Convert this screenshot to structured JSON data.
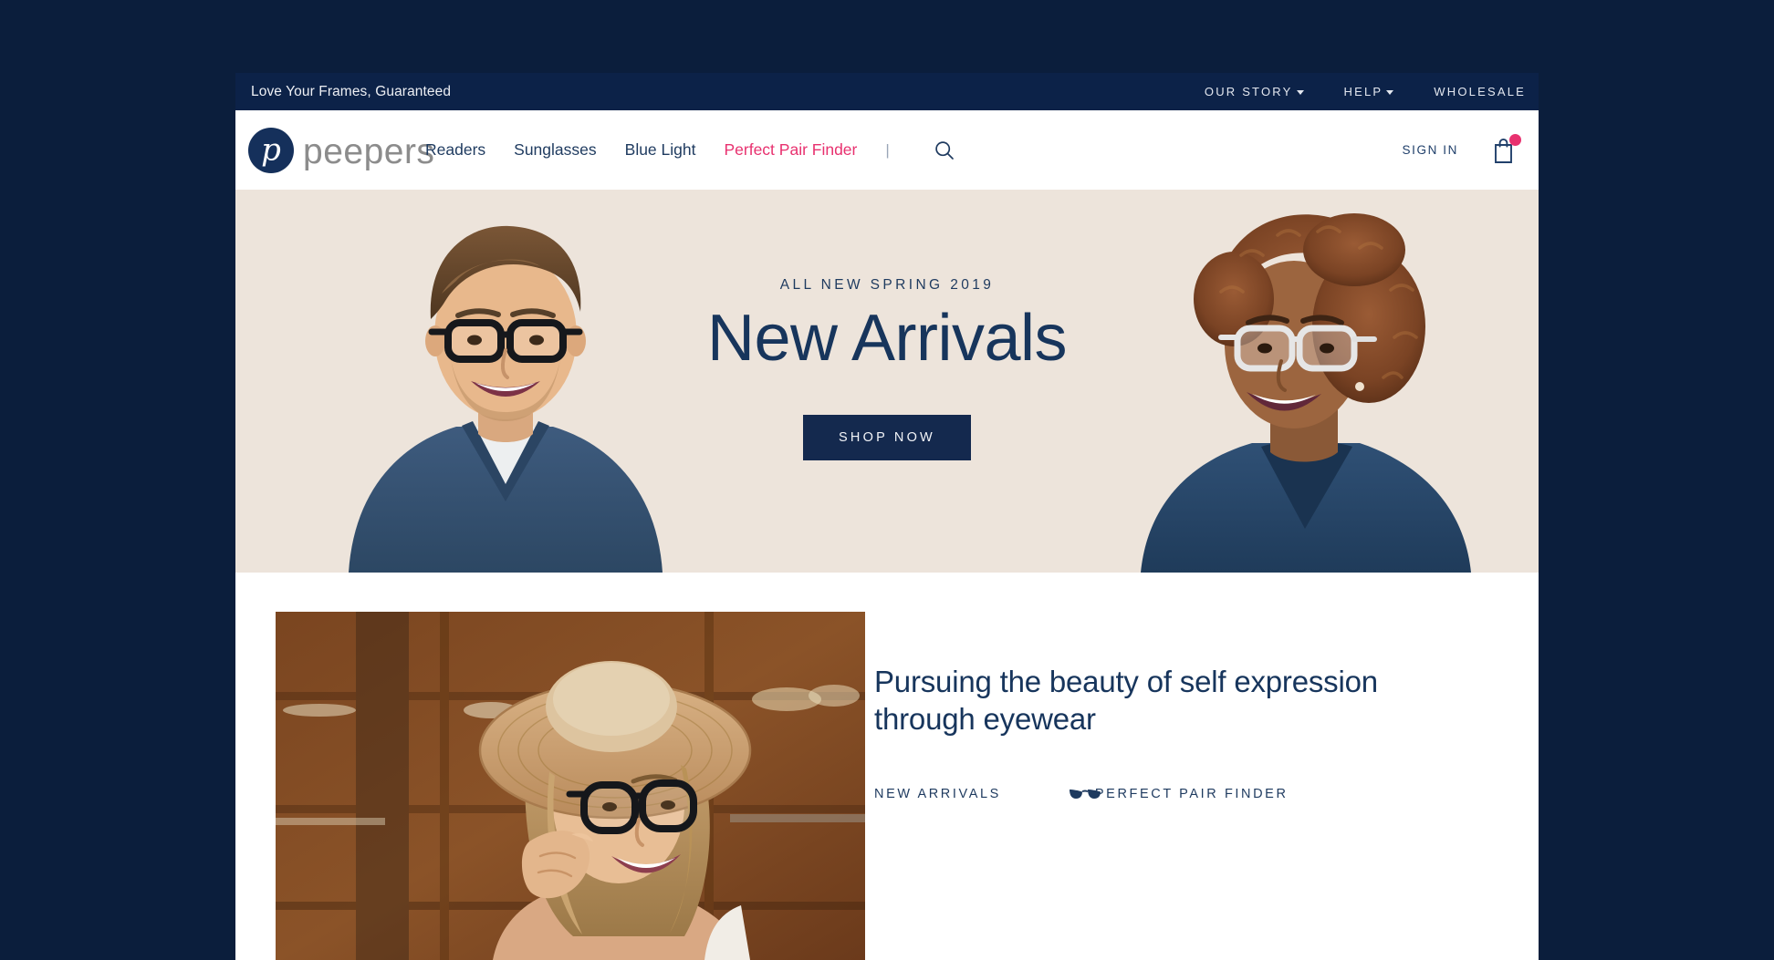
{
  "colors": {
    "page_background": "#0B1E3C",
    "topbar_background": "#0C2248",
    "navy": "#17355C",
    "accent_pink": "#E8316F",
    "hero_background": "#EDE4DB",
    "cta_background": "#14294E"
  },
  "topbar": {
    "message": "Love Your Frames, Guaranteed",
    "links": [
      {
        "label": "OUR STORY",
        "has_caret": true,
        "icon": "chevron-down-icon"
      },
      {
        "label": "HELP",
        "has_caret": true,
        "icon": "chevron-down-icon"
      },
      {
        "label": "WHOLESALE",
        "has_caret": false,
        "icon": ""
      }
    ]
  },
  "header": {
    "logo": {
      "mark_letter": "p",
      "wordmark": "peepers"
    },
    "nav": [
      {
        "label": "Readers",
        "accent": false
      },
      {
        "label": "Sunglasses",
        "accent": false
      },
      {
        "label": "Blue Light",
        "accent": false
      },
      {
        "label": "Perfect Pair Finder",
        "accent": true
      }
    ],
    "separator": "|",
    "search_icon": "search-icon",
    "sign_in": "SIGN IN",
    "cart_icon": "shopping-bag-icon",
    "cart_badge": ""
  },
  "hero": {
    "eyebrow": "ALL NEW SPRING 2019",
    "title": "New Arrivals",
    "cta": "SHOP NOW",
    "left_photo_alt": "smiling man in black eyeglasses and blue v-neck sweater",
    "right_photo_alt": "smiling woman in clear eyeglasses and blue blouse"
  },
  "story": {
    "image_alt": "smiling woman in straw sun hat adjusting black eyeglasses",
    "heading": "Pursuing the beauty of self expression through eyewear",
    "links": [
      {
        "label": "NEW ARRIVALS",
        "icon": ""
      },
      {
        "label": "PERFECT PAIR FINDER",
        "icon": "eyeglasses-icon"
      }
    ]
  }
}
